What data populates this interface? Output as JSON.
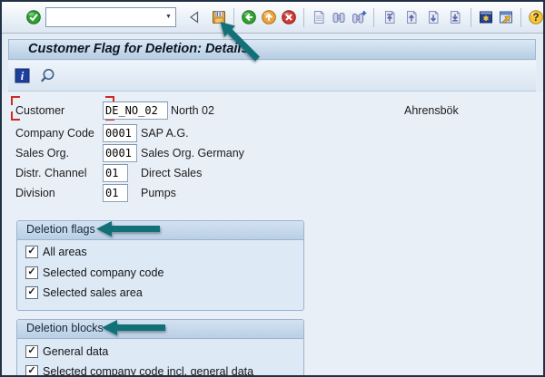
{
  "title_bar": {
    "title": "Customer Flag for Deletion: Details"
  },
  "toolbar": {
    "command_value": ""
  },
  "glyphs": {
    "dropdown": "▼",
    "check": "✓",
    "question": "?",
    "info": "i"
  },
  "form": {
    "rows": [
      {
        "label": "Customer",
        "value": "DE_NO_02",
        "desc": "North 02",
        "extra": "Ahrensbök"
      },
      {
        "label": "Company Code",
        "value": "0001",
        "desc": "SAP A.G."
      },
      {
        "label": "Sales Org.",
        "value": "0001",
        "desc": "Sales Org. Germany"
      },
      {
        "label": "Distr. Channel",
        "value": "01",
        "desc": "Direct Sales"
      },
      {
        "label": "Division",
        "value": "01",
        "desc": "Pumps"
      }
    ]
  },
  "groups": [
    {
      "title": "Deletion flags",
      "checkboxes": [
        {
          "label": "All areas",
          "checked": true
        },
        {
          "label": "Selected company code",
          "checked": true
        },
        {
          "label": "Selected sales area",
          "checked": true
        }
      ]
    },
    {
      "title": "Deletion blocks",
      "checkboxes": [
        {
          "label": "General data",
          "checked": true
        },
        {
          "label": "Selected company code incl. general data",
          "checked": true
        }
      ]
    }
  ],
  "colors": {
    "annotation_arrow": "#117078",
    "selection_brackets": "#cf2b24",
    "groupbox_body": "#dde9f5",
    "title_bar_top": "#dbe8f4",
    "title_bar_bottom": "#b7cde2",
    "window_border": "#223246"
  },
  "icons": {
    "enter-icon": "green-circle-check",
    "collapse-command-icon": "left-outline-triangle",
    "save-icon": "gold-floppy-disk",
    "back-icon": "green-circle-left-arrow",
    "exit-icon": "orange-circle-up-arrow",
    "cancel-icon": "red-circle-x",
    "print-icon": "document-sheet",
    "find-icon": "binoculars",
    "find-next-icon": "binoculars-plus",
    "first-page-icon": "page-arrow-top",
    "previous-page-icon": "page-arrow-up",
    "next-page-icon": "page-arrow-down",
    "last-page-icon": "page-arrow-bottom",
    "new-session-icon": "window-asterisk",
    "shortcut-icon": "window-ne-arrow",
    "help-icon": "yellow-circle-question",
    "customize-icon": "panel-red-green",
    "info-icon": "blue-square-i",
    "display-icon": "magnifier",
    "annotation-arrow-icon": "teal-arrow"
  }
}
